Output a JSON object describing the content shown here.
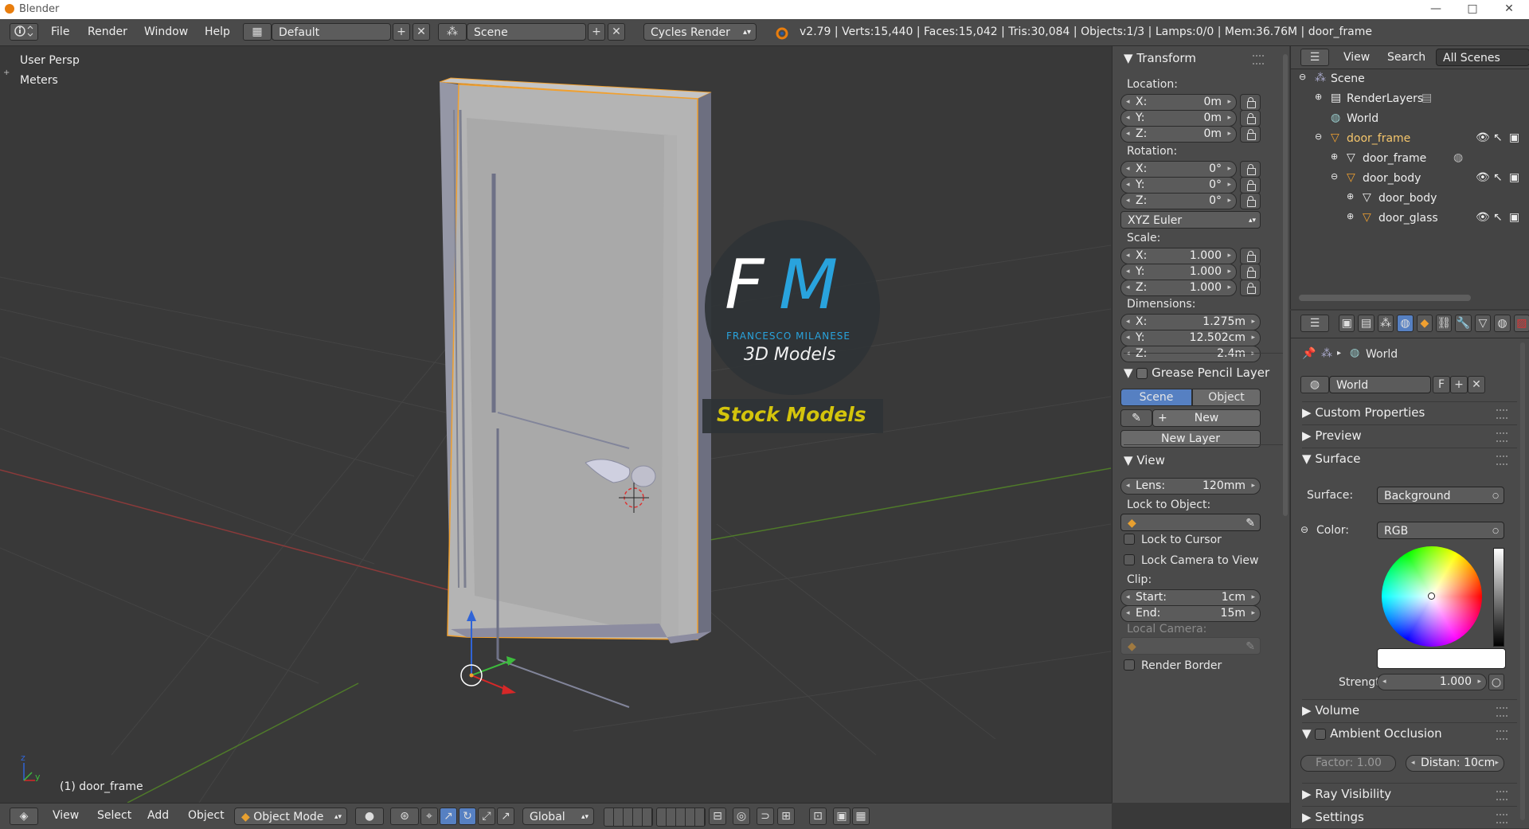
{
  "window": {
    "title": "Blender",
    "minimize": "—",
    "maximize": "□",
    "close": "✕"
  },
  "infobar": {
    "menus": [
      "File",
      "Render",
      "Window",
      "Help"
    ],
    "layout": "Default",
    "scene": "Scene",
    "engine": "Cycles Render",
    "stats": "v2.79 | Verts:15,440 | Faces:15,042 | Tris:30,084 | Objects:1/3 | Lamps:0/0 | Mem:36.76M | door_frame"
  },
  "viewport": {
    "view_name": "User Persp",
    "units": "Meters",
    "active_object": "(1) door_frame",
    "watermark": {
      "initials_f": "F",
      "initials_m": "M",
      "brand": "FRANCESCO MILANESE",
      "tagline": "3D Models",
      "banner": "Stock Models"
    }
  },
  "npanel": {
    "transform": {
      "title": "Transform",
      "location_label": "Location:",
      "location": [
        [
          "X:",
          "0m"
        ],
        [
          "Y:",
          "0m"
        ],
        [
          "Z:",
          "0m"
        ]
      ],
      "rotation_label": "Rotation:",
      "rotation": [
        [
          "X:",
          "0°"
        ],
        [
          "Y:",
          "0°"
        ],
        [
          "Z:",
          "0°"
        ]
      ],
      "rotation_mode": "XYZ Euler",
      "scale_label": "Scale:",
      "scale": [
        [
          "X:",
          "1.000"
        ],
        [
          "Y:",
          "1.000"
        ],
        [
          "Z:",
          "1.000"
        ]
      ],
      "dimensions_label": "Dimensions:",
      "dimensions": [
        [
          "X:",
          "1.275m"
        ],
        [
          "Y:",
          "12.502cm"
        ],
        [
          "Z:",
          "2.4m"
        ]
      ]
    },
    "grease_pencil": {
      "title": "Grease Pencil Layer",
      "tab_scene": "Scene",
      "tab_object": "Object",
      "new_label": "New",
      "new_layer_label": "New Layer"
    },
    "view": {
      "title": "View",
      "lens_label": "Lens:",
      "lens_value": "120mm",
      "lock_object_label": "Lock to Object:",
      "lock_cursor": "Lock to Cursor",
      "lock_camera": "Lock Camera to View",
      "clip_label": "Clip:",
      "clip_start_label": "Start:",
      "clip_start": "1cm",
      "clip_end_label": "End:",
      "clip_end": "15m",
      "local_camera_label": "Local Camera:",
      "render_border": "Render Border"
    }
  },
  "outliner": {
    "menus": [
      "View",
      "Search"
    ],
    "filter": "All Scenes",
    "rows": [
      "Scene",
      "RenderLayers",
      "World",
      "door_frame",
      "door_frame",
      "door_body",
      "door_body",
      "door_glass"
    ]
  },
  "properties": {
    "context": "World",
    "world_name": "World",
    "fake_user": "F",
    "sections": {
      "custom_properties": "Custom Properties",
      "preview": "Preview",
      "surface": "Surface",
      "volume": "Volume",
      "ambient_occlusion": "Ambient Occlusion",
      "ray_visibility": "Ray Visibility",
      "settings": "Settings"
    },
    "surface_label": "Surface:",
    "surface_value": "Background",
    "color_label": "Color:",
    "color_value": "RGB",
    "strength_label": "Strength:",
    "strength_value": "1.000",
    "ao_factor": "Factor:  1.00",
    "ao_distance": "Distan: 10cm"
  },
  "bottombar": {
    "menus": [
      "View",
      "Select",
      "Add",
      "Object"
    ],
    "mode": "Object Mode",
    "orientation": "Global"
  },
  "colors": {
    "accent_blue": "#5680c2",
    "selection_orange": "#f0a030",
    "brand_blue": "#29a3dd",
    "banner_yellow": "#d4c40c"
  }
}
